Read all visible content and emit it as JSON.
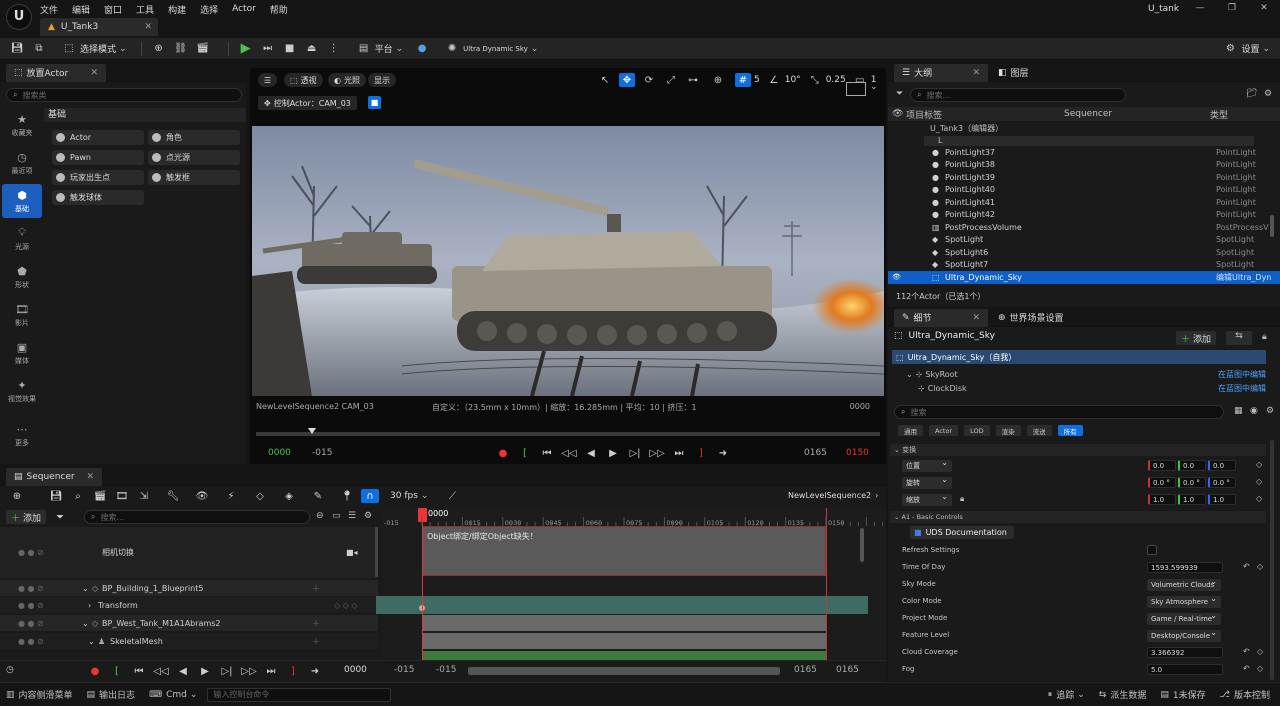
{
  "app": {
    "logo": "U",
    "menu": [
      "文件",
      "编辑",
      "窗口",
      "工具",
      "构建",
      "选择",
      "Actor",
      "帮助"
    ],
    "project_tab": "U_Tank3",
    "project_name": "U_tank"
  },
  "toolbar": {
    "mode_label": "选择模式",
    "platform_label": "平台",
    "sky_label": "Ultra Dynamic Sky",
    "settings_label": "设置"
  },
  "place_actor": {
    "tab": "放置Actor",
    "search_placeholder": "搜索类",
    "section": "基础",
    "categories": [
      {
        "icon": "star-icon",
        "label": "收藏夹"
      },
      {
        "icon": "clock-icon",
        "label": "最近项"
      },
      {
        "icon": "cube-icon",
        "label": "基础"
      },
      {
        "icon": "light-icon",
        "label": "光源"
      },
      {
        "icon": "shape-icon",
        "label": "形状"
      },
      {
        "icon": "film-icon",
        "label": "影片"
      },
      {
        "icon": "media-icon",
        "label": "媒体"
      },
      {
        "icon": "fx-icon",
        "label": "视觉效果"
      },
      {
        "icon": "more-icon",
        "label": "更多"
      }
    ],
    "items": [
      "Actor",
      "角色",
      "Pawn",
      "点光源",
      "玩家出生点",
      "触发框",
      "触发球体"
    ]
  },
  "viewport": {
    "btn_perspective": "透视",
    "btn_lit": "光照",
    "btn_show": "显示",
    "pilot_label": "控制Actor：CAM_03",
    "grid_value": "5",
    "rot_value": "10°",
    "scale_value": "0.25",
    "cam_speed": "1",
    "sequence_cam": "NewLevelSequence2 CAM_03",
    "info": "自定义：（23.5mm x 10mm）| 缩放：16.285mm | 平均：10 | 挤压：1",
    "frame_right": "0000",
    "time_start": "0000",
    "time_start2": "-015",
    "time_end": "0165",
    "time_end2": "0150"
  },
  "outliner": {
    "tab1": "大纲",
    "tab2": "图层",
    "search_placeholder": "搜索...",
    "col_label": "项目标签",
    "col_seq": "Sequencer",
    "col_type": "类型",
    "root": "U_Tank3（编辑器）",
    "folder": "L",
    "rows": [
      {
        "name": "PointLight37",
        "type": "PointLight"
      },
      {
        "name": "PointLight38",
        "type": "PointLight"
      },
      {
        "name": "PointLight39",
        "type": "PointLight"
      },
      {
        "name": "PointLight40",
        "type": "PointLight"
      },
      {
        "name": "PointLight41",
        "type": "PointLight"
      },
      {
        "name": "PointLight42",
        "type": "PointLight"
      },
      {
        "name": "PostProcessVolume",
        "type": "PostProcessV"
      },
      {
        "name": "SpotLight",
        "type": "SpotLight"
      },
      {
        "name": "SpotLight6",
        "type": "SpotLight"
      },
      {
        "name": "SpotLight7",
        "type": "SpotLight"
      },
      {
        "name": "Ultra_Dynamic_Sky",
        "type": "编辑Ultra_Dyn"
      }
    ],
    "count": "112个Actor（已选1个）"
  },
  "details": {
    "tab1": "细节",
    "tab2": "世界场景设置",
    "object": "Ultra_Dynamic_Sky",
    "add_label": "添加",
    "self_row": "Ultra_Dynamic_Sky（自我）",
    "comp1": "SkyRoot",
    "comp2": "ClockDisk",
    "edit_bp": "在蓝图中编辑",
    "search_placeholder": "搜索",
    "filters": [
      "通用",
      "Actor",
      "LOD",
      "渲染",
      "流送",
      "所有"
    ],
    "transform_header": "变换",
    "location_label": "位置",
    "rotation_label": "旋转",
    "scale_label": "缩放",
    "loc": [
      "0.0",
      "0.0",
      "0.0"
    ],
    "rot": [
      "0.0 °",
      "0.0 °",
      "0.0 °"
    ],
    "scl": [
      "1.0",
      "1.0",
      "1.0"
    ],
    "section_a1": "A1 - Basic Controls",
    "uds_doc": "UDS Documentation",
    "props": [
      {
        "label": "Refresh Settings",
        "kind": "check",
        "value": ""
      },
      {
        "label": "Time Of Day",
        "kind": "num",
        "value": "1593.599939"
      },
      {
        "label": "Sky Mode",
        "kind": "drop",
        "value": "Volumetric Clouds"
      },
      {
        "label": "Color Mode",
        "kind": "drop",
        "value": "Sky Atmosphere"
      },
      {
        "label": "Project Mode",
        "kind": "drop",
        "value": "Game / Real-time"
      },
      {
        "label": "Feature Level",
        "kind": "drop",
        "value": "Desktop/Console"
      },
      {
        "label": "Cloud Coverage",
        "kind": "num",
        "value": "3.366392"
      },
      {
        "label": "Fog",
        "kind": "num",
        "value": "5.0"
      }
    ]
  },
  "sequencer": {
    "tab": "Sequencer",
    "fps": "30 fps",
    "seq_name": "NewLevelSequence2",
    "add_label": "添加",
    "search_placeholder": "搜索...",
    "tracks": [
      {
        "label": "相机切换",
        "level": 0
      },
      {
        "label": "BP_Building_1_Blueprint5",
        "level": 0
      },
      {
        "label": "Transform",
        "level": 1
      },
      {
        "label": "BP_West_Tank_M1A1Abrams2",
        "level": 0
      },
      {
        "label": "SkeletalMesh",
        "level": 1
      }
    ],
    "ruler": [
      "-015",
      "0000",
      "0015",
      "0030",
      "0045",
      "0060",
      "0075",
      "0090",
      "0105",
      "0120",
      "0135",
      "0150"
    ],
    "current": "0000",
    "warning": "Object绑定/绑定Object缺失！",
    "bottom_frame": "0000",
    "bottom_start": "-015",
    "bottom_start2": "-015",
    "bottom_end": "0165",
    "bottom_end2": "0165"
  },
  "statusbar": {
    "content_drawer": "内容侧滑菜单",
    "output_log": "输出日志",
    "cmd": "Cmd",
    "cmd_placeholder": "输入控制台命令",
    "trace": "追踪",
    "derived": "派生数据",
    "unsaved": "1未保存",
    "version": "版本控制"
  }
}
